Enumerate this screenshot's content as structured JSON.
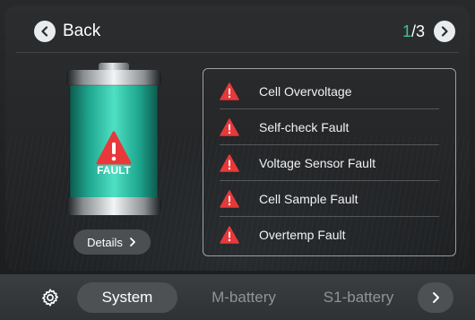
{
  "header": {
    "back_label": "Back",
    "page_current": "1",
    "page_total_text": "/3"
  },
  "battery": {
    "status_label": "FAULT",
    "details_label": "Details"
  },
  "faults": [
    {
      "label": "Cell Overvoltage"
    },
    {
      "label": "Self-check Fault"
    },
    {
      "label": "Voltage Sensor Fault"
    },
    {
      "label": "Cell Sample Fault"
    },
    {
      "label": "Overtemp Fault"
    }
  ],
  "bottom_nav": {
    "tabs": [
      {
        "label": "System",
        "active": true
      },
      {
        "label": "M-battery",
        "active": false
      },
      {
        "label": "S1-battery",
        "active": false
      }
    ],
    "settings_icon": "gear-icon",
    "next_icon": "chevron-right-icon"
  },
  "colors": {
    "accent_green": "#3fc29a",
    "fault_red": "#e8383a",
    "battery_teal": "#22b39a"
  }
}
